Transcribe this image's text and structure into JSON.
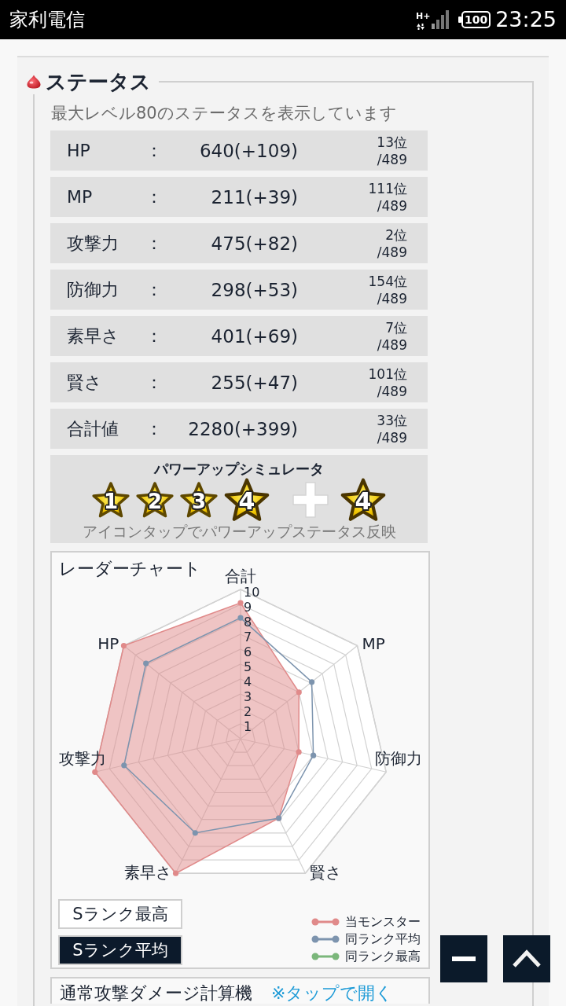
{
  "status_bar": {
    "carrier": "家利電信",
    "network": "H+",
    "battery": "100",
    "time": "23:25"
  },
  "status_section": {
    "title": "ステータス",
    "subtitle": "最大レベル80のステータスを表示しています",
    "stats": [
      {
        "label": "HP",
        "colon": "：",
        "value": "640(+109)",
        "rank": "13位",
        "out_of": "/489"
      },
      {
        "label": "MP",
        "colon": "：",
        "value": "211(+39)",
        "rank": "111位",
        "out_of": "/489"
      },
      {
        "label": "攻撃力",
        "colon": "：",
        "value": "475(+82)",
        "rank": "2位",
        "out_of": "/489"
      },
      {
        "label": "防御力",
        "colon": "：",
        "value": "298(+53)",
        "rank": "154位",
        "out_of": "/489"
      },
      {
        "label": "素早さ",
        "colon": "：",
        "value": "401(+69)",
        "rank": "7位",
        "out_of": "/489"
      },
      {
        "label": "賢さ",
        "colon": "：",
        "value": "255(+47)",
        "rank": "101位",
        "out_of": "/489"
      },
      {
        "label": "合計値",
        "colon": "：",
        "value": "2280(+399)",
        "rank": "33位",
        "out_of": "/489"
      }
    ]
  },
  "power_up": {
    "title": "パワーアップシミュレータ",
    "stars": [
      {
        "label": "1",
        "selected": false
      },
      {
        "label": "2",
        "selected": false
      },
      {
        "label": "3",
        "selected": false
      },
      {
        "label": "4",
        "selected": true
      }
    ],
    "bonus_star": {
      "label": "4"
    },
    "caption": "アイコンタップでパワーアップステータス反映"
  },
  "radar": {
    "title": "レーダーチャート",
    "chart_data": {
      "type": "radar",
      "categories": [
        "合計",
        "MP",
        "防御力",
        "賢さ",
        "素早さ",
        "攻撃力",
        "HP"
      ],
      "series": [
        {
          "name": "当モンスター",
          "color": "#e08a8a",
          "values": [
            9.1,
            5,
            4,
            5.9,
            10,
            10,
            10
          ]
        },
        {
          "name": "同ランク平均",
          "color": "#7d94ae",
          "values": [
            8.1,
            6.1,
            5,
            5.9,
            7,
            8,
            8.1
          ]
        },
        {
          "name": "同ランク最高",
          "color": "#7bb77b",
          "values": [
            null,
            null,
            null,
            null,
            null,
            null,
            null
          ]
        }
      ],
      "ylim": [
        0,
        10
      ],
      "yticks": [
        1,
        2,
        3,
        4,
        5,
        6,
        7,
        8,
        9,
        10
      ]
    },
    "rank_buttons": [
      {
        "label": "Sランク最高",
        "selected": false
      },
      {
        "label": "Sランク平均",
        "selected": true
      }
    ]
  },
  "calculator": {
    "title": "通常攻撃ダメージ計算機",
    "link": "※タップで開く"
  }
}
